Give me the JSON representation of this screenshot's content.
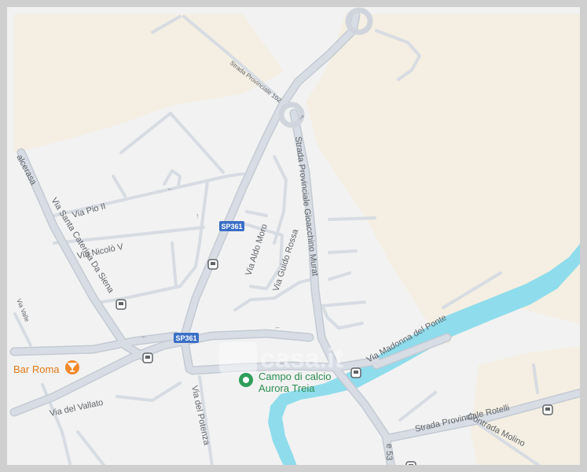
{
  "map": {
    "roads": {
      "sp361_top": "SP361",
      "sp361_bottom": "SP361",
      "strada_provinciale_gioacchino_murat": "Strada Provinciale Gioacchino Murat",
      "strada_provinciale_top": "Strada Provinciale 102",
      "via_pio_ii": "Via Pio II",
      "via_nicolo_v": "Via Nicolò V",
      "via_santa_caterina": "Via Santa Caterina Da Siena",
      "via_aldo_moro": "Via Aldo Moro",
      "via_guido_rossa": "Via Guido Rossa",
      "via_madonna_del_ponte": "Via Madonna del Ponte",
      "via_del_vallato": "Via del Vallato",
      "via_del_potenza": "Via del Potenza",
      "strada_provinciale_rotelli": "Strada Provinciale Rotelli",
      "contrada_molino": "Contrada Molino",
      "valcerasa": "alcerasa",
      "via_valle_left": "Via Valle",
      "sp53_fragment": "e 53"
    },
    "pois": {
      "bar_roma": "Bar Roma",
      "campo_line1": "Campo di calcio",
      "campo_line2": "Aurora Treia"
    },
    "watermark": "casa.it",
    "colors": {
      "background": "#f2f2f2",
      "land": "#f4efe2",
      "road": "#d3d8e0",
      "road_outline": "#c2c8d2",
      "river": "#8fdcec",
      "label": "#5f6368",
      "shield": "#3b6fc6",
      "bar_pin": "#f08a2c",
      "park_pin": "#2e9e5b",
      "transit": "#5f6368"
    }
  }
}
